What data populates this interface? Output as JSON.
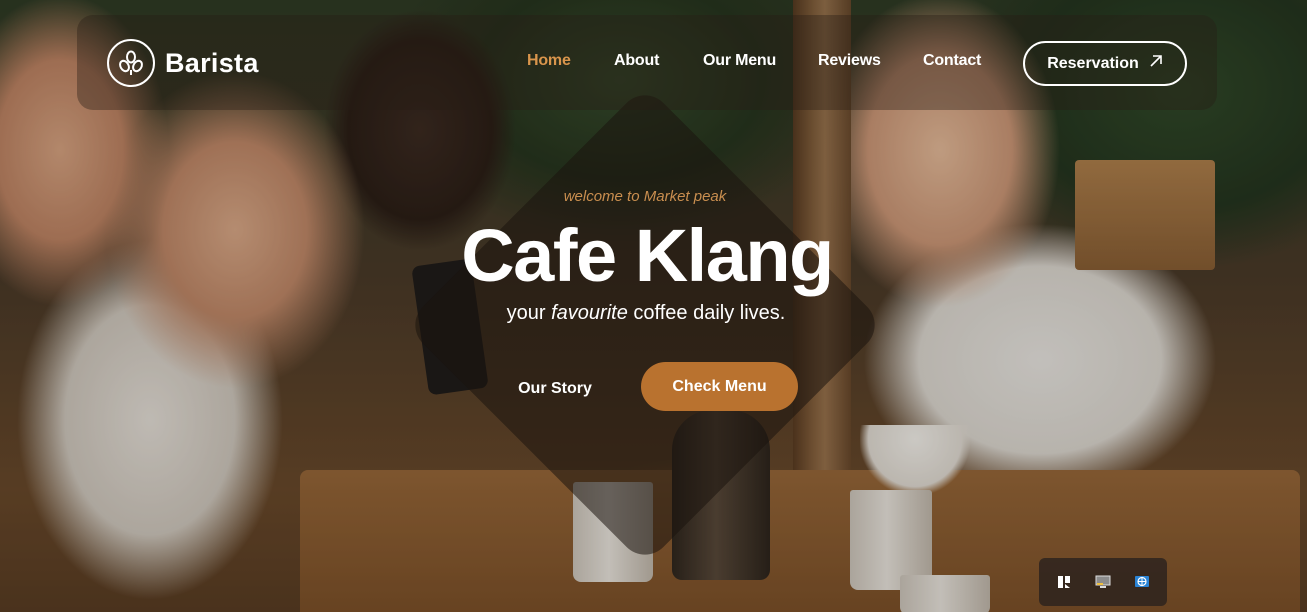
{
  "brand": {
    "name": "Barista",
    "icon": "coffee-beans-logo-icon"
  },
  "nav": {
    "items": [
      {
        "label": "Home",
        "active": true
      },
      {
        "label": "About",
        "active": false
      },
      {
        "label": "Our Menu",
        "active": false
      },
      {
        "label": "Reviews",
        "active": false
      },
      {
        "label": "Contact",
        "active": false
      }
    ],
    "cta": {
      "label": "Reservation",
      "icon": "arrow-up-right-icon"
    }
  },
  "hero": {
    "eyebrow": "welcome to Market peak",
    "title": "Cafe Klang",
    "subtitle_before": "your ",
    "subtitle_emphasis": "favourite",
    "subtitle_after": " coffee daily lives.",
    "secondary_button": "Our Story",
    "primary_button": "Check Menu"
  },
  "colors": {
    "accent": "#b9722f",
    "active_nav": "#d9954c",
    "eyebrow": "#c98e4f",
    "text": "#ffffff"
  },
  "tray": {
    "icons": [
      "snap-layout-icon",
      "display-icon",
      "network-globe-icon"
    ]
  }
}
